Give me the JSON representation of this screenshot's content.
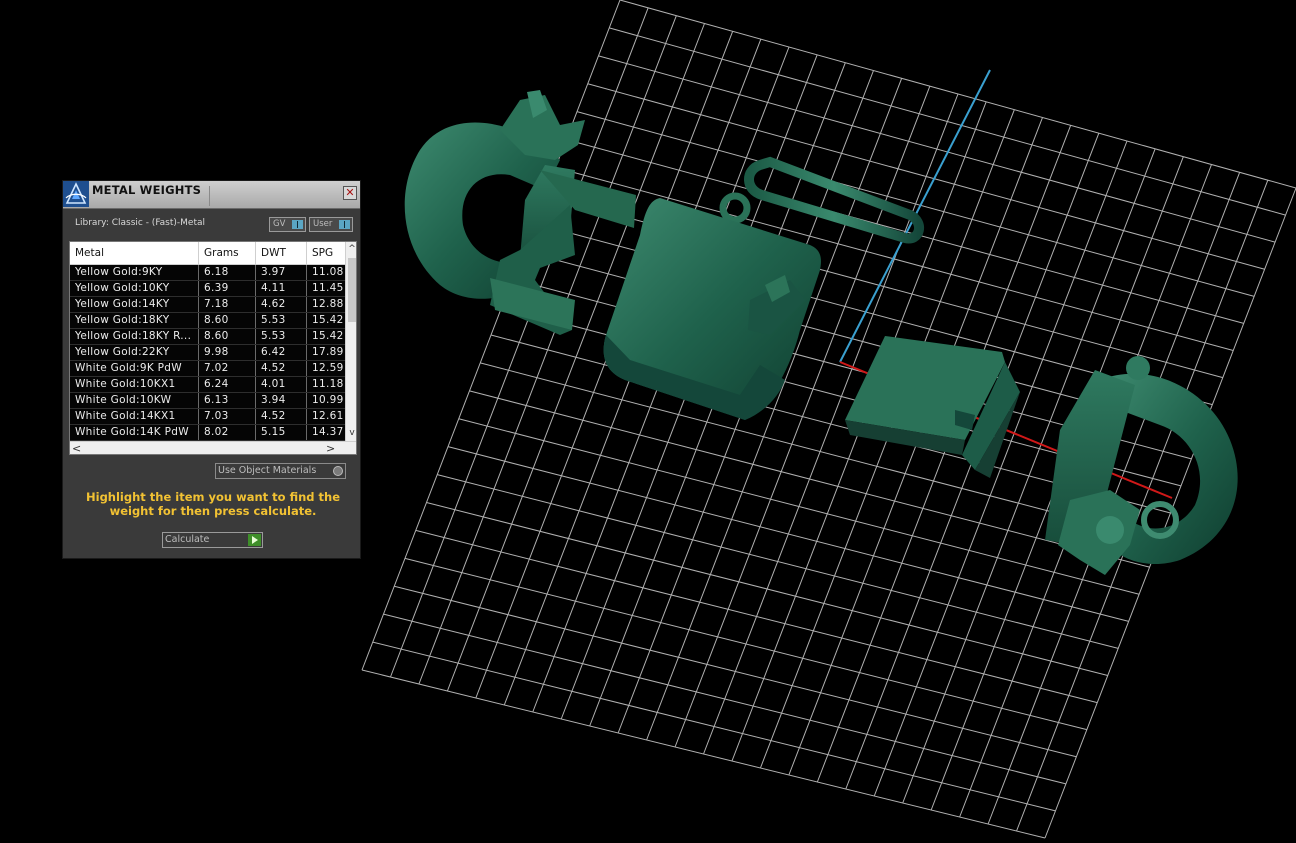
{
  "panel": {
    "title": "METAL WEIGHTS",
    "close_symbol": "✕",
    "library_label": "Library: Classic - (Fast)-Metal",
    "toggles": {
      "gv": "GV",
      "user": "User"
    },
    "columns": [
      "Metal",
      "Grams",
      "DWT",
      "SPG"
    ],
    "rows": [
      [
        "Yellow Gold:9KY",
        "6.18",
        "3.97",
        "11.08"
      ],
      [
        "Yellow Gold:10KY",
        "6.39",
        "4.11",
        "11.45"
      ],
      [
        "Yellow Gold:14KY",
        "7.18",
        "4.62",
        "12.88"
      ],
      [
        "Yellow Gold:18KY",
        "8.60",
        "5.53",
        "15.42"
      ],
      [
        "Yellow Gold:18KY R...",
        "8.60",
        "5.53",
        "15.42"
      ],
      [
        "Yellow Gold:22KY",
        "9.98",
        "6.42",
        "17.89"
      ],
      [
        "White Gold:9K PdW",
        "7.02",
        "4.52",
        "12.59"
      ],
      [
        "White Gold:10KX1",
        "6.24",
        "4.01",
        "11.18"
      ],
      [
        "White Gold:10KW",
        "6.13",
        "3.94",
        "10.99"
      ],
      [
        "White Gold:14KX1",
        "7.03",
        "4.52",
        "12.61"
      ],
      [
        "White Gold:14K PdW",
        "8.02",
        "5.15",
        "14.37"
      ]
    ],
    "use_object_materials": "Use Object Materials",
    "instruction": "Highlight the item you want to find the weight for then press calculate.",
    "calculate_label": "Calculate",
    "scroll": {
      "up": "^",
      "down": "v",
      "left": "<",
      "right": ">"
    }
  },
  "colors": {
    "model": "#1d5c48",
    "grid": "#d8d8d8",
    "axis_y": "#3aa0d0",
    "axis_x": "#d01818",
    "instruction_text": "#f2c233"
  },
  "icons": [
    "app-logo-icon",
    "close-icon",
    "toggle-knob-icon",
    "radio-icon",
    "play-arrow-icon"
  ]
}
